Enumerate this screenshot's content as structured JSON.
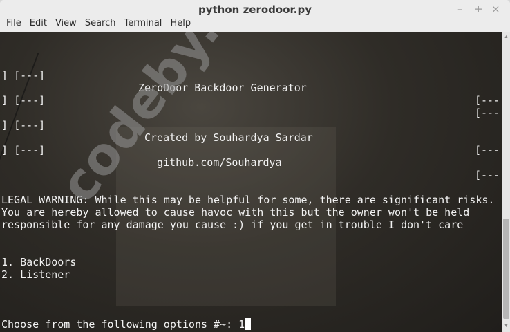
{
  "window": {
    "title": "python zerodoor.py",
    "minimize": "–",
    "maximize": "+",
    "close": "×"
  },
  "menu": [
    "File",
    "Edit",
    "View",
    "Search",
    "Terminal",
    "Help"
  ],
  "terminal": {
    "bracket_open": "[---]",
    "bracket_partial": "[---",
    "bracket_close": "]",
    "banner_title": "ZeroDoor Backdoor Generator",
    "banner_author": "Created by Souhardya Sardar",
    "banner_github": "github.com/Souhardya",
    "warning": [
      "LEGAL WARNING: While this may be helpful for some, there are significant risks.",
      "You are hereby allowed to cause havoc with this but the owner won't be held",
      "responsible for any damage you cause :) if you get in trouble I don't care"
    ],
    "options": [
      "1. BackDoors",
      "2. Listener"
    ],
    "prompt": "Choose from the following options #~: ",
    "input": "1"
  },
  "watermark": "codeby.net"
}
